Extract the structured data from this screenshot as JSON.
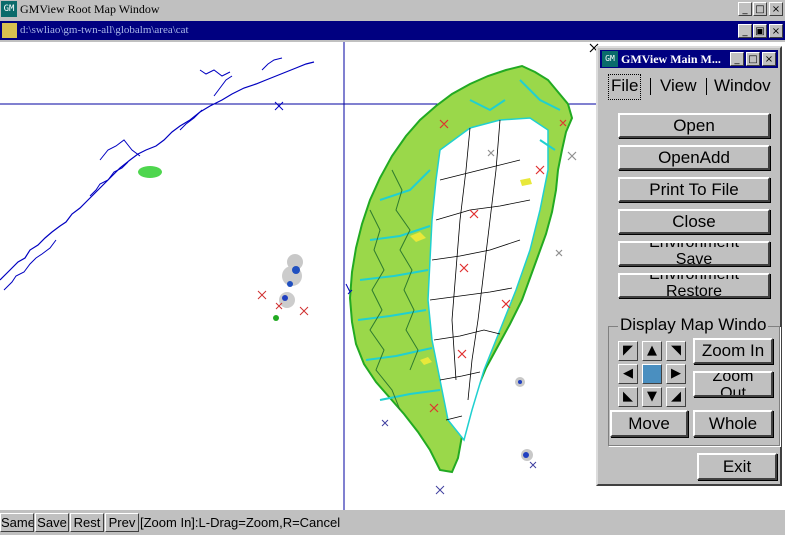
{
  "root_window": {
    "title": "GMView Root Map Window",
    "icon_label": "GM",
    "controls": {
      "minimize": "_",
      "maximize": "□",
      "close": "×"
    }
  },
  "document_bar": {
    "path": "d:\\swliao\\gm-twn-all\\globalm\\area\\cat",
    "controls": {
      "minimize": "_",
      "restore": "▣",
      "close": "×"
    }
  },
  "main_window": {
    "title": "GMView Main M...",
    "icon_label": "GM",
    "controls": {
      "minimize": "_",
      "maximize": "□",
      "close": "×"
    },
    "tabs": [
      "File",
      "View",
      "Windov"
    ],
    "file_buttons": {
      "open": "Open",
      "open_add": "OpenAdd",
      "print_to_file": "Print To File",
      "close": "Close",
      "env_save_line1": "Environment",
      "env_save_line2": "Save",
      "env_restore_line1": "Environment",
      "env_restore_line2": "Restore"
    },
    "display_group_label": "Display Map Windo",
    "arrows": {
      "nw": "◤",
      "n": "▲",
      "ne": "◥",
      "w": "◀",
      "e": "▶",
      "sw": "◣",
      "s": "▼",
      "se": "◢"
    },
    "zoom_in": "Zoom In",
    "zoom_out_line1": "Zoom",
    "zoom_out_line2": "Out",
    "move": "Move",
    "whole": "Whole",
    "exit": "Exit"
  },
  "status_bar": {
    "buttons": [
      "Same",
      "Save",
      "Rest",
      "Prev"
    ],
    "message": "[Zoom In]:L-Drag=Zoom,R=Cancel"
  },
  "colors": {
    "title_active": "#000080",
    "map_background": "#ffffff",
    "coast_blue": "#0000c0",
    "vegetation_green": "#22cc22",
    "river_cyan": "#20d0d0",
    "marker_red": "#e03030"
  }
}
